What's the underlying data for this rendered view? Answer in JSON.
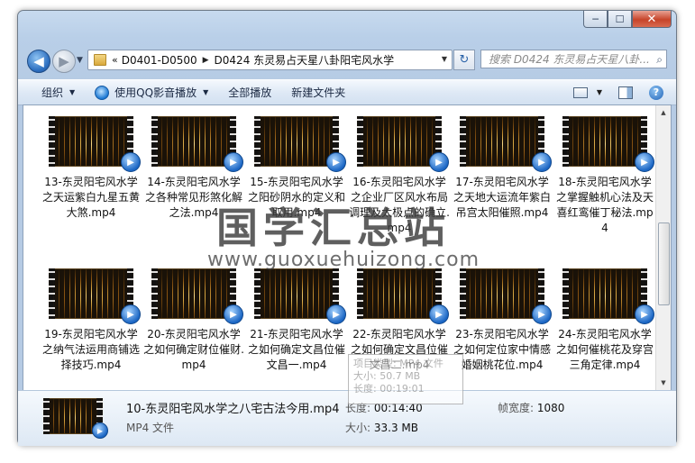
{
  "window": {
    "caption_buttons": {
      "minimize": "─",
      "maximize": "☐",
      "close": "✕"
    }
  },
  "address": {
    "more": "«",
    "crumbs": [
      "D0401-D0500",
      "D0424 东灵易占天星八卦阳宅风水学"
    ],
    "search_placeholder": "搜索 D0424 东灵易占天星八卦..."
  },
  "toolbar": {
    "organize": "组织",
    "play_with_qq": "使用QQ影音播放",
    "play_all": "全部播放",
    "new_folder": "新建文件夹"
  },
  "files": {
    "row1": [
      "13-东灵阳宅风水学之天运紫白九星五黄大煞.mp4",
      "14-东灵阳宅风水学之各种常见形煞化解之法.mp4",
      "15-东灵阳宅风水学之阳砂阴水的定义和取用.mp4",
      "16-东灵阳宅风水学之企业厂区风水布局调理及太极点的确立.mp4",
      "17-东灵阳宅风水学之天地大运流年紫白吊宫太阳催照.mp4",
      "18-东灵阳宅风水学之掌握触机心法及天喜红鸾催丁秘法.mp4"
    ],
    "row2": [
      "19-东灵阳宅风水学之纳气法运用商铺选择技巧.mp4",
      "20-东灵阳宅风水学之如何确定财位催财.mp4",
      "21-东灵阳宅风水学之如何确定文昌位催文昌一.mp4",
      "22-东灵阳宅风水学之如何确定文昌位催文昌二.mp4",
      "23-东灵阳宅风水学之如何定位家中情感婚姻桃花位.mp4",
      "24-东灵阳宅风水学之如何催桃花及穿宫三角定律.mp4"
    ]
  },
  "watermark": {
    "title": "国学汇总站",
    "url": "www.guoxuehuizong.com"
  },
  "tooltip": {
    "type": "项目类型: MP4 文件",
    "size": "大小: 50.7 MB",
    "length": "长度: 00:19:01"
  },
  "details": {
    "name": "10-东灵阳宅风水学之八宅古法今用.mp4",
    "type": "MP4 文件",
    "length_label": "长度:",
    "length_value": "00:14:40",
    "size_label": "大小:",
    "size_value": "33.3 MB",
    "width_label": "帧宽度:",
    "width_value": "1080"
  },
  "colors": {
    "chrome_blue": "#b9cfe8",
    "toolbar_text": "#1c2a44",
    "accent_blue": "#1b66c4"
  }
}
